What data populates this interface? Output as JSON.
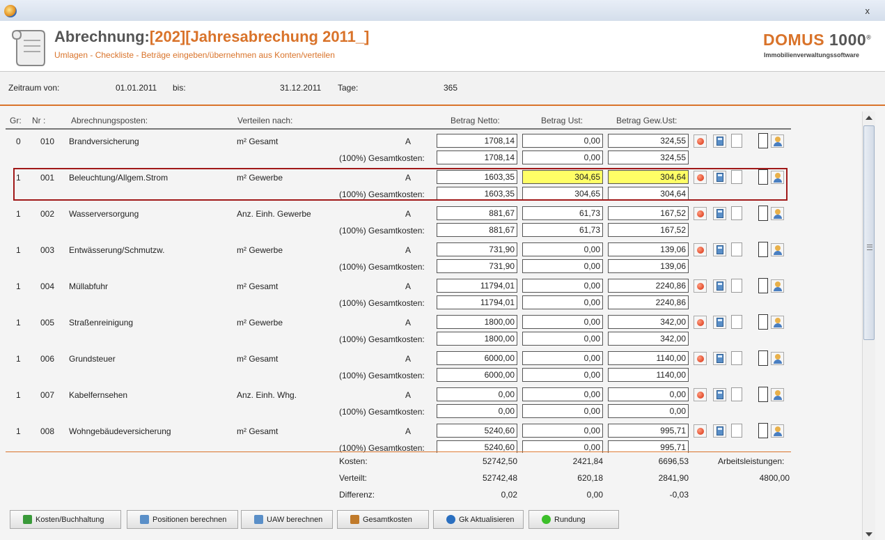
{
  "window": {
    "close_label": "x"
  },
  "header": {
    "title_prefix": "Abrechnung:",
    "title_accent": "[202][Jahresabrechung 2011_]",
    "subtitle": "Umlagen - Checkliste - Beträge eingeben/übernehmen aus Konten/verteilen",
    "logo_main": "DOMUS",
    "logo_num": "1000",
    "logo_reg": "®",
    "logo_sub": "Immobilienverwaltungssoftware"
  },
  "period": {
    "from_label": "Zeitraum von:",
    "from_value": "01.01.2011",
    "to_label": "bis:",
    "to_value": "31.12.2011",
    "days_label": "Tage:",
    "days_value": "365"
  },
  "columns": {
    "gr": "Gr:",
    "nr": "Nr :",
    "posten": "Abrechnungsposten:",
    "verteilen": "Verteilen nach:",
    "netto": "Betrag Netto:",
    "ust": "Betrag Ust:",
    "gew": "Betrag Gew.Ust:"
  },
  "total_costs_label": "(100%) Gesamtkosten:",
  "rows": [
    {
      "gr": "0",
      "nr": "010",
      "posten": "Brandversicherung",
      "verteilen": "m² Gesamt",
      "code": "A",
      "netto": "1708,14",
      "ust": "0,00",
      "gew": "324,55",
      "t_netto": "1708,14",
      "t_ust": "0,00",
      "t_gew": "324,55",
      "hl": false
    },
    {
      "gr": "1",
      "nr": "001",
      "posten": "Beleuchtung/Allgem.Strom",
      "verteilen": "m² Gewerbe",
      "code": "A",
      "netto": "1603,35",
      "ust": "304,65",
      "gew": "304,64",
      "t_netto": "1603,35",
      "t_ust": "304,65",
      "t_gew": "304,64",
      "hl": true
    },
    {
      "gr": "1",
      "nr": "002",
      "posten": "Wasserversorgung",
      "verteilen": "Anz. Einh. Gewerbe",
      "code": "A",
      "netto": "881,67",
      "ust": "61,73",
      "gew": "167,52",
      "t_netto": "881,67",
      "t_ust": "61,73",
      "t_gew": "167,52",
      "hl": false
    },
    {
      "gr": "1",
      "nr": "003",
      "posten": "Entwässerung/Schmutzw.",
      "verteilen": "m² Gewerbe",
      "code": "A",
      "netto": "731,90",
      "ust": "0,00",
      "gew": "139,06",
      "t_netto": "731,90",
      "t_ust": "0,00",
      "t_gew": "139,06",
      "hl": false
    },
    {
      "gr": "1",
      "nr": "004",
      "posten": "Müllabfuhr",
      "verteilen": "m² Gesamt",
      "code": "A",
      "netto": "11794,01",
      "ust": "0,00",
      "gew": "2240,86",
      "t_netto": "11794,01",
      "t_ust": "0,00",
      "t_gew": "2240,86",
      "hl": false
    },
    {
      "gr": "1",
      "nr": "005",
      "posten": "Straßenreinigung",
      "verteilen": "m² Gewerbe",
      "code": "A",
      "netto": "1800,00",
      "ust": "0,00",
      "gew": "342,00",
      "t_netto": "1800,00",
      "t_ust": "0,00",
      "t_gew": "342,00",
      "hl": false
    },
    {
      "gr": "1",
      "nr": "006",
      "posten": "Grundsteuer",
      "verteilen": "m² Gesamt",
      "code": "A",
      "netto": "6000,00",
      "ust": "0,00",
      "gew": "1140,00",
      "t_netto": "6000,00",
      "t_ust": "0,00",
      "t_gew": "1140,00",
      "hl": false
    },
    {
      "gr": "1",
      "nr": "007",
      "posten": "Kabelfernsehen",
      "verteilen": "Anz. Einh. Whg.",
      "code": "A",
      "netto": "0,00",
      "ust": "0,00",
      "gew": "0,00",
      "t_netto": "0,00",
      "t_ust": "0,00",
      "t_gew": "0,00",
      "hl": false
    },
    {
      "gr": "1",
      "nr": "008",
      "posten": "Wohngebäudeversicherung",
      "verteilen": "m² Gesamt",
      "code": "A",
      "netto": "5240,60",
      "ust": "0,00",
      "gew": "995,71",
      "t_netto": "5240,60",
      "t_ust": "0,00",
      "t_gew": "995,71",
      "hl": false
    }
  ],
  "totals": {
    "kosten_label": "Kosten:",
    "kosten": [
      "52742,50",
      "2421,84",
      "6696,53"
    ],
    "verteilt_label": "Verteilt:",
    "verteilt": [
      "52742,48",
      "620,18",
      "2841,90"
    ],
    "differenz_label": "Differenz:",
    "differenz": [
      "0,02",
      "0,00",
      "-0,03"
    ],
    "arbeit_label": "Arbeitsleistungen:",
    "arbeit_value": "4800,00"
  },
  "buttons": [
    {
      "label": "Kosten/Buchhaltung",
      "icon": "shield-icon",
      "color": "#3a9a3a"
    },
    {
      "label": "Positionen berechnen",
      "icon": "calculator-icon",
      "color": "#5a8fc8"
    },
    {
      "label": "UAW berechnen",
      "icon": "table-icon",
      "color": "#5a8fc8"
    },
    {
      "label": "Gesamtkosten",
      "icon": "edit-icon",
      "color": "#c07a2a"
    },
    {
      "label": "Gk Aktualisieren",
      "icon": "refresh-icon",
      "color": "#2a6fc0"
    },
    {
      "label": "Rundung",
      "icon": "green-dot-icon",
      "color": "#3cbf2a"
    }
  ]
}
